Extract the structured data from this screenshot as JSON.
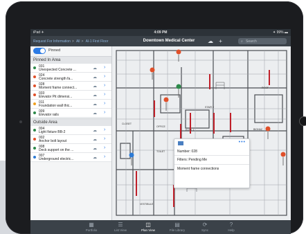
{
  "status_bar": {
    "carrier": "iPad ✈",
    "time": "4:09 PM",
    "right": "✦ 99% ▬"
  },
  "nav": {
    "breadcrumbs": [
      "Request For Information",
      "All",
      "Al-1 First Floor"
    ],
    "title": "Downtown Medical Center",
    "search_placeholder": "Search"
  },
  "sidebar": {
    "pinned_label": "Pinned",
    "pinned_header": "Pinned In Area",
    "outside_header": "Outside Area",
    "pinned_items": [
      {
        "number": "031",
        "title": "Unexpected Concrete ...",
        "color": "#2d8a4a"
      },
      {
        "number": "024",
        "title": "Concrete strength fa...",
        "color": "#e0502a"
      },
      {
        "number": "028",
        "title": "Moment frame connect...",
        "color": "#e0502a"
      },
      {
        "number": "033",
        "title": "Elevator Pit dimensi...",
        "color": "#e0502a"
      },
      {
        "number": "011",
        "title": "Foundation wall thic...",
        "color": "#f0a020"
      },
      {
        "number": "009",
        "title": "Elevator rails",
        "color": "#2d8a4a"
      }
    ],
    "outside_items": [
      {
        "number": "004",
        "title": "Light fixture BB-2",
        "color": "#2d8a4a"
      },
      {
        "number": "002",
        "title": "Anchor bolt layout",
        "color": "#e0502a"
      },
      {
        "number": "008",
        "title": "Deck support on the ...",
        "color": "#2d8a4a"
      },
      {
        "number": "007",
        "title": "Underground electric...",
        "color": "#2d7bd5"
      }
    ]
  },
  "map": {
    "room_labels": [
      "STAIR 2",
      "ELEV. 1",
      "ELEV. 2",
      "OFFICE",
      "TOILET",
      "CLOSET",
      "ROOF",
      "NURSE",
      "BIOHAZ",
      "WAITING",
      "VESTIBULE"
    ]
  },
  "popup": {
    "number_line": "Number: 028",
    "filters_line": "Filters: Pending Me",
    "title_line": "Moment frame connections"
  },
  "tabs": [
    {
      "label": "Portfolio",
      "icon": "portfolio-icon",
      "glyph": "▦"
    },
    {
      "label": "List View",
      "icon": "list-icon",
      "glyph": "☰"
    },
    {
      "label": "Plan View",
      "icon": "map-icon",
      "glyph": "◫"
    },
    {
      "label": "File Library",
      "icon": "folder-icon",
      "glyph": "▤"
    },
    {
      "label": "Sync",
      "icon": "sync-icon",
      "glyph": "⟳"
    },
    {
      "label": "Help",
      "icon": "help-icon",
      "glyph": "?"
    }
  ],
  "colors": {
    "accent": "#2c7be5",
    "nav_bg": "#3b4249",
    "pin_orange": "#e0502a",
    "pin_green": "#2d8a4a",
    "pin_blue": "#2d7bd5"
  }
}
